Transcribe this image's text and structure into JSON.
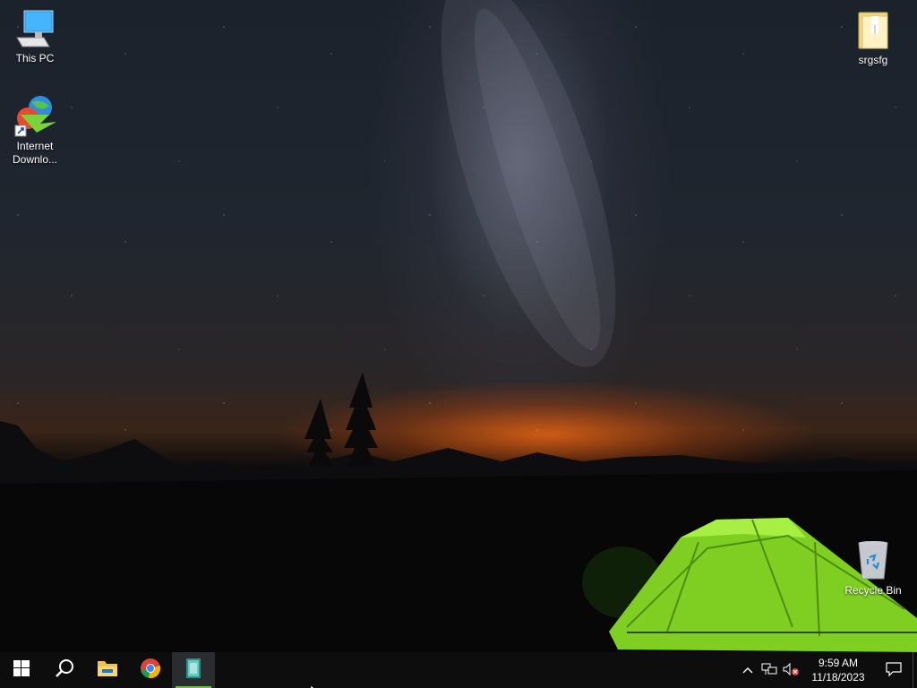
{
  "desktop": {
    "icons": [
      {
        "label": "This PC",
        "icon": "this-pc-icon"
      },
      {
        "label": "Internet Downlo...",
        "icon": "internet-download-manager-icon"
      },
      {
        "label": "srgsfg",
        "icon": "folder-icon"
      },
      {
        "label": "Recycle Bin",
        "icon": "recycle-bin-icon"
      }
    ]
  },
  "taskbar": {
    "buttons": [
      {
        "name": "Start",
        "icon": "windows-start-icon"
      },
      {
        "name": "Search",
        "icon": "search-icon"
      },
      {
        "name": "File Explorer",
        "icon": "file-explorer-icon"
      },
      {
        "name": "Google Chrome",
        "icon": "chrome-icon"
      },
      {
        "name": "Notepad-like app",
        "icon": "app-icon",
        "active": true
      }
    ],
    "tray": {
      "time": "9:59 AM",
      "date": "11/18/2023"
    }
  },
  "colors": {
    "taskbar": "#0d0d0e",
    "active_indicator": "#76b947",
    "tent": "#8fdc2c"
  }
}
